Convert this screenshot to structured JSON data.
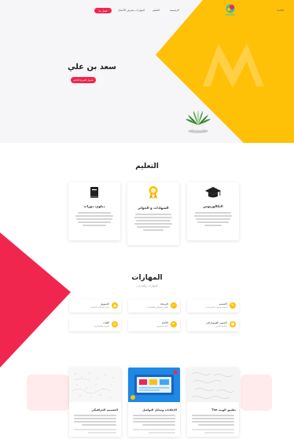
{
  "colors": {
    "accent": "#f0264f",
    "hero_yellow": "#ffc107",
    "bg": "#f6f6f8"
  },
  "nav": {
    "logo_icon": "logo-icon",
    "contact_button": "اتصل بنا",
    "links": [
      "معرض الأعمال",
      "المهارات",
      "التعليم",
      "الرئيسية"
    ],
    "menu_label": "القائمة"
  },
  "hero": {
    "name": "سعد بن علي",
    "button": "تحميل السيرة الذاتية",
    "decor_icon": "plant-icon"
  },
  "education": {
    "title": "التعليم",
    "cards": [
      {
        "icon": "book-icon",
        "title": "دبلوم، دورات"
      },
      {
        "icon": "award-icon",
        "title": "الشهادات و الجوائز"
      },
      {
        "icon": "graduation-cap-icon",
        "title": "البكالوريوس"
      }
    ]
  },
  "skills": {
    "title": "المهارات",
    "subtitle": "المهارات والخبرات",
    "items": [
      {
        "icon": "pencil-icon",
        "name": "التصميم",
        "desc": "تصميم واجهات المستخدم",
        "color": "#ffc107"
      },
      {
        "icon": "code-icon",
        "name": "البرمجة",
        "desc": "تطوير المواقع والتطبيقات",
        "color": "#ffc107"
      },
      {
        "icon": "chart-icon",
        "name": "التسويق",
        "desc": "إدارة الحملات الإعلانية",
        "color": "#ffc107"
      },
      {
        "icon": "camera-icon",
        "name": "التصوير الفوتوغرافي",
        "desc": "معالجة الصور",
        "color": "#ffc107"
      },
      {
        "icon": "pen-icon",
        "name": "الكتابة",
        "desc": "كتابة المحتوى",
        "color": "#ffc107"
      },
      {
        "icon": "globe-icon",
        "name": "اللغات",
        "desc": "العربية والإنجليزية",
        "color": "#ffc107"
      }
    ]
  },
  "portfolio": {
    "items": [
      {
        "title": "The تطبيق الويب"
      },
      {
        "title": "الإعلانات وسائل التواصل"
      },
      {
        "title": "التصميم الجرافيكي"
      }
    ]
  }
}
